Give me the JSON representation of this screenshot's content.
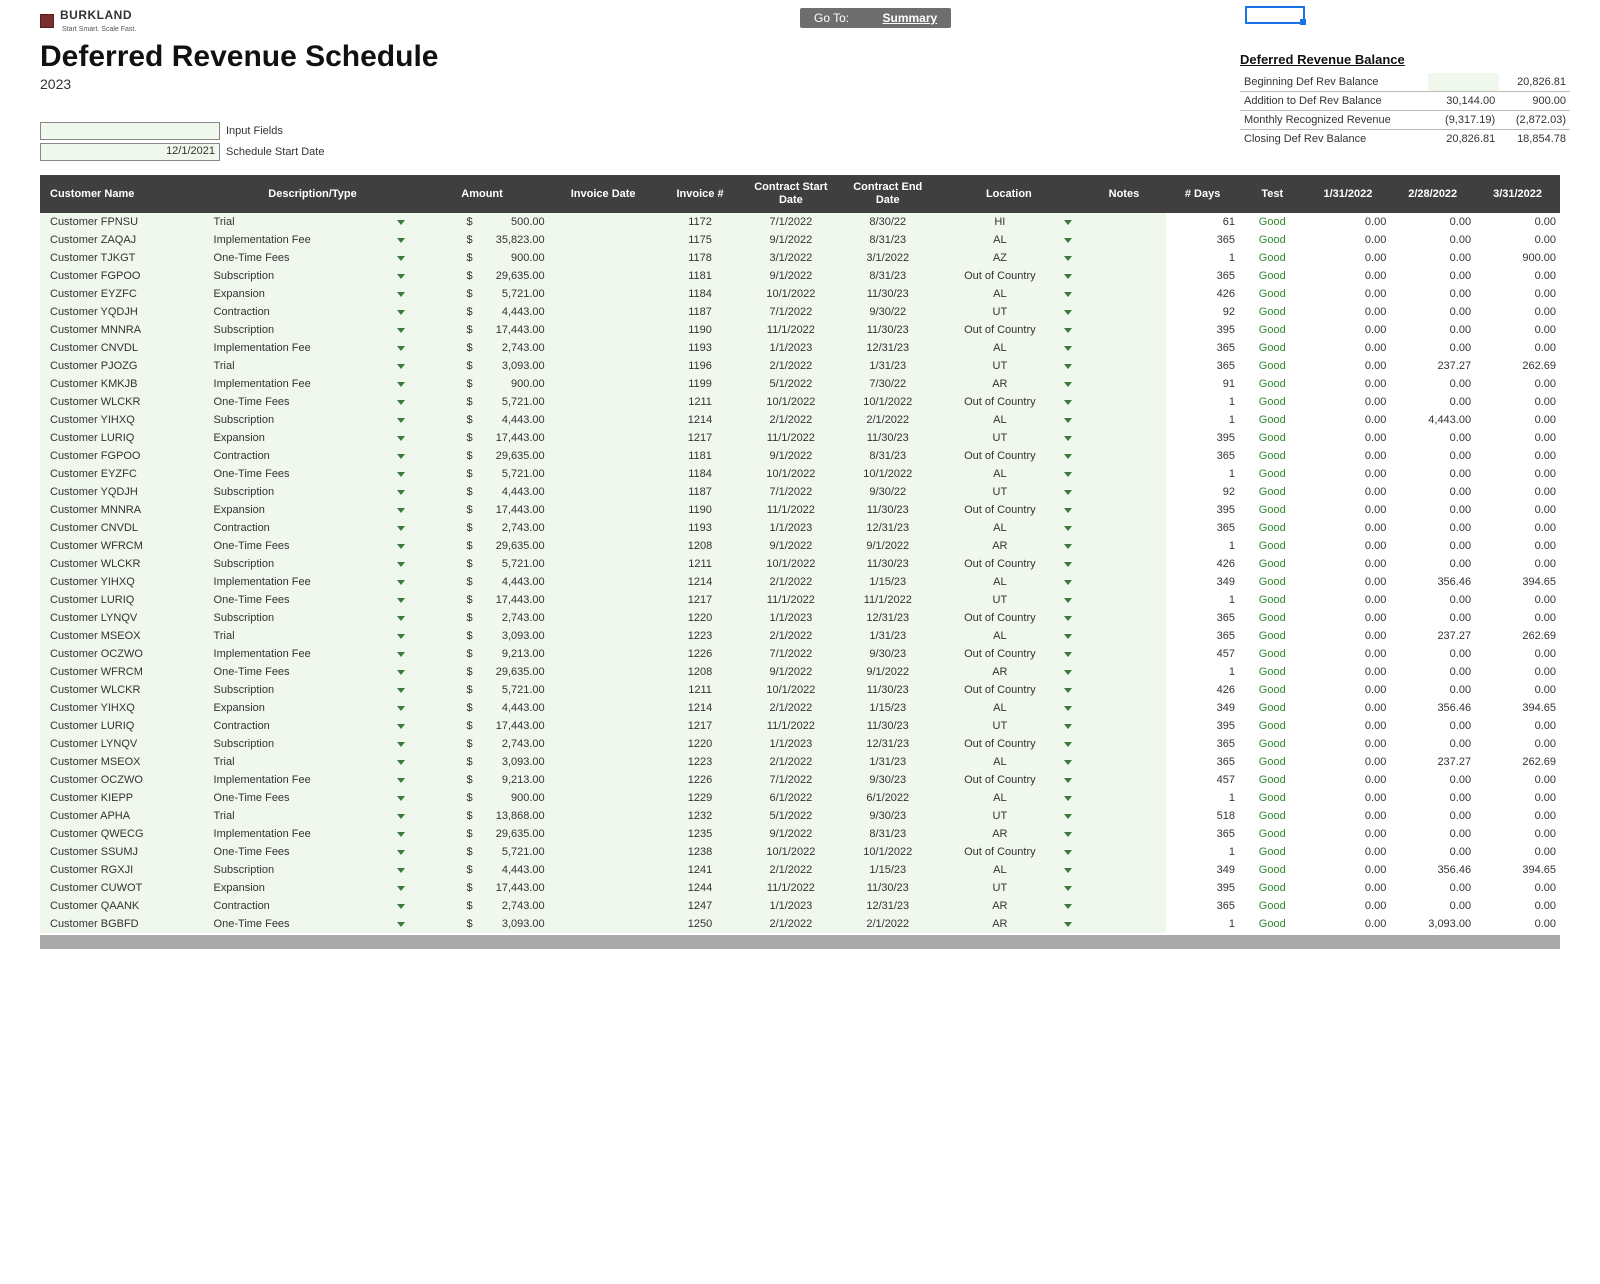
{
  "brand": {
    "name": "BURKLAND",
    "tagline": "Start Smart. Scale Fast."
  },
  "nav": {
    "goto_label": "Go To:",
    "summary_link": "Summary"
  },
  "header": {
    "title": "Deferred Revenue Schedule",
    "year": "2023"
  },
  "inputs": {
    "input_fields_label": "Input Fields",
    "schedule_start_date_label": "Schedule Start Date",
    "schedule_start_date_value": "12/1/2021"
  },
  "balance": {
    "heading": "Deferred Revenue Balance",
    "rows": [
      {
        "label": "Beginning Def Rev Balance",
        "c1": "",
        "c2": "20,826.81",
        "blank1": true
      },
      {
        "label": "Addition to Def Rev Balance",
        "c1": "30,144.00",
        "c2": "900.00"
      },
      {
        "label": "Monthly Recognized Revenue",
        "c1": "(9,317.19)",
        "c2": "(2,872.03)"
      },
      {
        "label": "Closing Def Rev Balance",
        "c1": "20,826.81",
        "c2": "18,854.78"
      }
    ]
  },
  "columns": {
    "customer": "Customer Name",
    "desc": "Description/Type",
    "amount": "Amount",
    "invoice_date": "Invoice Date",
    "invoice_no": "Invoice #",
    "contract_start": "Contract Start Date",
    "contract_end": "Contract End Date",
    "location": "Location",
    "notes": "Notes",
    "days": "# Days",
    "test": "Test",
    "m1": "1/31/2022",
    "m2": "2/28/2022",
    "m3": "3/31/2022"
  },
  "test_label": "Good",
  "rows": [
    {
      "cust": "Customer FPNSU",
      "desc": "Trial",
      "amt": "500.00",
      "inv": "1172",
      "cs": "7/1/2022",
      "ce": "8/30/22",
      "loc": "HI",
      "days": "61",
      "m1": "0.00",
      "m2": "0.00",
      "m3": "0.00"
    },
    {
      "cust": "Customer ZAQAJ",
      "desc": "Implementation Fee",
      "amt": "35,823.00",
      "inv": "1175",
      "cs": "9/1/2022",
      "ce": "8/31/23",
      "loc": "AL",
      "days": "365",
      "m1": "0.00",
      "m2": "0.00",
      "m3": "0.00"
    },
    {
      "cust": "Customer TJKGT",
      "desc": "One-Time Fees",
      "amt": "900.00",
      "inv": "1178",
      "cs": "3/1/2022",
      "ce": "3/1/2022",
      "loc": "AZ",
      "days": "1",
      "m1": "0.00",
      "m2": "0.00",
      "m3": "900.00"
    },
    {
      "cust": "Customer FGPOO",
      "desc": "Subscription",
      "amt": "29,635.00",
      "inv": "1181",
      "cs": "9/1/2022",
      "ce": "8/31/23",
      "loc": "Out of Country",
      "days": "365",
      "m1": "0.00",
      "m2": "0.00",
      "m3": "0.00"
    },
    {
      "cust": "Customer EYZFC",
      "desc": "Expansion",
      "amt": "5,721.00",
      "inv": "1184",
      "cs": "10/1/2022",
      "ce": "11/30/23",
      "loc": "AL",
      "days": "426",
      "m1": "0.00",
      "m2": "0.00",
      "m3": "0.00"
    },
    {
      "cust": "Customer YQDJH",
      "desc": "Contraction",
      "amt": "4,443.00",
      "inv": "1187",
      "cs": "7/1/2022",
      "ce": "9/30/22",
      "loc": "UT",
      "days": "92",
      "m1": "0.00",
      "m2": "0.00",
      "m3": "0.00"
    },
    {
      "cust": "Customer MNNRA",
      "desc": "Subscription",
      "amt": "17,443.00",
      "inv": "1190",
      "cs": "11/1/2022",
      "ce": "11/30/23",
      "loc": "Out of Country",
      "days": "395",
      "m1": "0.00",
      "m2": "0.00",
      "m3": "0.00"
    },
    {
      "cust": "Customer CNVDL",
      "desc": "Implementation Fee",
      "amt": "2,743.00",
      "inv": "1193",
      "cs": "1/1/2023",
      "ce": "12/31/23",
      "loc": "AL",
      "days": "365",
      "m1": "0.00",
      "m2": "0.00",
      "m3": "0.00"
    },
    {
      "cust": "Customer PJOZG",
      "desc": "Trial",
      "amt": "3,093.00",
      "inv": "1196",
      "cs": "2/1/2022",
      "ce": "1/31/23",
      "loc": "UT",
      "days": "365",
      "m1": "0.00",
      "m2": "237.27",
      "m3": "262.69"
    },
    {
      "cust": "Customer KMKJB",
      "desc": "Implementation Fee",
      "amt": "900.00",
      "inv": "1199",
      "cs": "5/1/2022",
      "ce": "7/30/22",
      "loc": "AR",
      "days": "91",
      "m1": "0.00",
      "m2": "0.00",
      "m3": "0.00"
    },
    {
      "cust": "Customer WLCKR",
      "desc": "One-Time Fees",
      "amt": "5,721.00",
      "inv": "1211",
      "cs": "10/1/2022",
      "ce": "10/1/2022",
      "loc": "Out of Country",
      "days": "1",
      "m1": "0.00",
      "m2": "0.00",
      "m3": "0.00"
    },
    {
      "cust": "Customer YIHXQ",
      "desc": "Subscription",
      "amt": "4,443.00",
      "inv": "1214",
      "cs": "2/1/2022",
      "ce": "2/1/2022",
      "loc": "AL",
      "days": "1",
      "m1": "0.00",
      "m2": "4,443.00",
      "m3": "0.00"
    },
    {
      "cust": "Customer LURIQ",
      "desc": "Expansion",
      "amt": "17,443.00",
      "inv": "1217",
      "cs": "11/1/2022",
      "ce": "11/30/23",
      "loc": "UT",
      "days": "395",
      "m1": "0.00",
      "m2": "0.00",
      "m3": "0.00"
    },
    {
      "cust": "Customer FGPOO",
      "desc": "Contraction",
      "amt": "29,635.00",
      "inv": "1181",
      "cs": "9/1/2022",
      "ce": "8/31/23",
      "loc": "Out of Country",
      "days": "365",
      "m1": "0.00",
      "m2": "0.00",
      "m3": "0.00"
    },
    {
      "cust": "Customer EYZFC",
      "desc": "One-Time Fees",
      "amt": "5,721.00",
      "inv": "1184",
      "cs": "10/1/2022",
      "ce": "10/1/2022",
      "loc": "AL",
      "days": "1",
      "m1": "0.00",
      "m2": "0.00",
      "m3": "0.00"
    },
    {
      "cust": "Customer YQDJH",
      "desc": "Subscription",
      "amt": "4,443.00",
      "inv": "1187",
      "cs": "7/1/2022",
      "ce": "9/30/22",
      "loc": "UT",
      "days": "92",
      "m1": "0.00",
      "m2": "0.00",
      "m3": "0.00"
    },
    {
      "cust": "Customer MNNRA",
      "desc": "Expansion",
      "amt": "17,443.00",
      "inv": "1190",
      "cs": "11/1/2022",
      "ce": "11/30/23",
      "loc": "Out of Country",
      "days": "395",
      "m1": "0.00",
      "m2": "0.00",
      "m3": "0.00"
    },
    {
      "cust": "Customer CNVDL",
      "desc": "Contraction",
      "amt": "2,743.00",
      "inv": "1193",
      "cs": "1/1/2023",
      "ce": "12/31/23",
      "loc": "AL",
      "days": "365",
      "m1": "0.00",
      "m2": "0.00",
      "m3": "0.00"
    },
    {
      "cust": "Customer WFRCM",
      "desc": "One-Time Fees",
      "amt": "29,635.00",
      "inv": "1208",
      "cs": "9/1/2022",
      "ce": "9/1/2022",
      "loc": "AR",
      "days": "1",
      "m1": "0.00",
      "m2": "0.00",
      "m3": "0.00"
    },
    {
      "cust": "Customer WLCKR",
      "desc": "Subscription",
      "amt": "5,721.00",
      "inv": "1211",
      "cs": "10/1/2022",
      "ce": "11/30/23",
      "loc": "Out of Country",
      "days": "426",
      "m1": "0.00",
      "m2": "0.00",
      "m3": "0.00"
    },
    {
      "cust": "Customer YIHXQ",
      "desc": "Implementation Fee",
      "amt": "4,443.00",
      "inv": "1214",
      "cs": "2/1/2022",
      "ce": "1/15/23",
      "loc": "AL",
      "days": "349",
      "m1": "0.00",
      "m2": "356.46",
      "m3": "394.65"
    },
    {
      "cust": "Customer LURIQ",
      "desc": "One-Time Fees",
      "amt": "17,443.00",
      "inv": "1217",
      "cs": "11/1/2022",
      "ce": "11/1/2022",
      "loc": "UT",
      "days": "1",
      "m1": "0.00",
      "m2": "0.00",
      "m3": "0.00"
    },
    {
      "cust": "Customer LYNQV",
      "desc": "Subscription",
      "amt": "2,743.00",
      "inv": "1220",
      "cs": "1/1/2023",
      "ce": "12/31/23",
      "loc": "Out of Country",
      "days": "365",
      "m1": "0.00",
      "m2": "0.00",
      "m3": "0.00"
    },
    {
      "cust": "Customer MSEOX",
      "desc": "Trial",
      "amt": "3,093.00",
      "inv": "1223",
      "cs": "2/1/2022",
      "ce": "1/31/23",
      "loc": "AL",
      "days": "365",
      "m1": "0.00",
      "m2": "237.27",
      "m3": "262.69"
    },
    {
      "cust": "Customer OCZWO",
      "desc": "Implementation Fee",
      "amt": "9,213.00",
      "inv": "1226",
      "cs": "7/1/2022",
      "ce": "9/30/23",
      "loc": "Out of Country",
      "days": "457",
      "m1": "0.00",
      "m2": "0.00",
      "m3": "0.00"
    },
    {
      "cust": "Customer WFRCM",
      "desc": "One-Time Fees",
      "amt": "29,635.00",
      "inv": "1208",
      "cs": "9/1/2022",
      "ce": "9/1/2022",
      "loc": "AR",
      "days": "1",
      "m1": "0.00",
      "m2": "0.00",
      "m3": "0.00"
    },
    {
      "cust": "Customer WLCKR",
      "desc": "Subscription",
      "amt": "5,721.00",
      "inv": "1211",
      "cs": "10/1/2022",
      "ce": "11/30/23",
      "loc": "Out of Country",
      "days": "426",
      "m1": "0.00",
      "m2": "0.00",
      "m3": "0.00"
    },
    {
      "cust": "Customer YIHXQ",
      "desc": "Expansion",
      "amt": "4,443.00",
      "inv": "1214",
      "cs": "2/1/2022",
      "ce": "1/15/23",
      "loc": "AL",
      "days": "349",
      "m1": "0.00",
      "m2": "356.46",
      "m3": "394.65"
    },
    {
      "cust": "Customer LURIQ",
      "desc": "Contraction",
      "amt": "17,443.00",
      "inv": "1217",
      "cs": "11/1/2022",
      "ce": "11/30/23",
      "loc": "UT",
      "days": "395",
      "m1": "0.00",
      "m2": "0.00",
      "m3": "0.00"
    },
    {
      "cust": "Customer LYNQV",
      "desc": "Subscription",
      "amt": "2,743.00",
      "inv": "1220",
      "cs": "1/1/2023",
      "ce": "12/31/23",
      "loc": "Out of Country",
      "days": "365",
      "m1": "0.00",
      "m2": "0.00",
      "m3": "0.00"
    },
    {
      "cust": "Customer MSEOX",
      "desc": "Trial",
      "amt": "3,093.00",
      "inv": "1223",
      "cs": "2/1/2022",
      "ce": "1/31/23",
      "loc": "AL",
      "days": "365",
      "m1": "0.00",
      "m2": "237.27",
      "m3": "262.69"
    },
    {
      "cust": "Customer OCZWO",
      "desc": "Implementation Fee",
      "amt": "9,213.00",
      "inv": "1226",
      "cs": "7/1/2022",
      "ce": "9/30/23",
      "loc": "Out of Country",
      "days": "457",
      "m1": "0.00",
      "m2": "0.00",
      "m3": "0.00"
    },
    {
      "cust": "Customer KIEPP",
      "desc": "One-Time Fees",
      "amt": "900.00",
      "inv": "1229",
      "cs": "6/1/2022",
      "ce": "6/1/2022",
      "loc": "AL",
      "days": "1",
      "m1": "0.00",
      "m2": "0.00",
      "m3": "0.00"
    },
    {
      "cust": "Customer APHA",
      "desc": "Trial",
      "amt": "13,868.00",
      "inv": "1232",
      "cs": "5/1/2022",
      "ce": "9/30/23",
      "loc": "UT",
      "days": "518",
      "m1": "0.00",
      "m2": "0.00",
      "m3": "0.00"
    },
    {
      "cust": "Customer QWECG",
      "desc": "Implementation Fee",
      "amt": "29,635.00",
      "inv": "1235",
      "cs": "9/1/2022",
      "ce": "8/31/23",
      "loc": "AR",
      "days": "365",
      "m1": "0.00",
      "m2": "0.00",
      "m3": "0.00"
    },
    {
      "cust": "Customer SSUMJ",
      "desc": "One-Time Fees",
      "amt": "5,721.00",
      "inv": "1238",
      "cs": "10/1/2022",
      "ce": "10/1/2022",
      "loc": "Out of Country",
      "days": "1",
      "m1": "0.00",
      "m2": "0.00",
      "m3": "0.00"
    },
    {
      "cust": "Customer RGXJI",
      "desc": "Subscription",
      "amt": "4,443.00",
      "inv": "1241",
      "cs": "2/1/2022",
      "ce": "1/15/23",
      "loc": "AL",
      "days": "349",
      "m1": "0.00",
      "m2": "356.46",
      "m3": "394.65"
    },
    {
      "cust": "Customer CUWOT",
      "desc": "Expansion",
      "amt": "17,443.00",
      "inv": "1244",
      "cs": "11/1/2022",
      "ce": "11/30/23",
      "loc": "UT",
      "days": "395",
      "m1": "0.00",
      "m2": "0.00",
      "m3": "0.00"
    },
    {
      "cust": "Customer QAANK",
      "desc": "Contraction",
      "amt": "2,743.00",
      "inv": "1247",
      "cs": "1/1/2023",
      "ce": "12/31/23",
      "loc": "AR",
      "days": "365",
      "m1": "0.00",
      "m2": "0.00",
      "m3": "0.00"
    },
    {
      "cust": "Customer BGBFD",
      "desc": "One-Time Fees",
      "amt": "3,093.00",
      "inv": "1250",
      "cs": "2/1/2022",
      "ce": "2/1/2022",
      "loc": "AR",
      "days": "1",
      "m1": "0.00",
      "m2": "3,093.00",
      "m3": "0.00"
    }
  ]
}
